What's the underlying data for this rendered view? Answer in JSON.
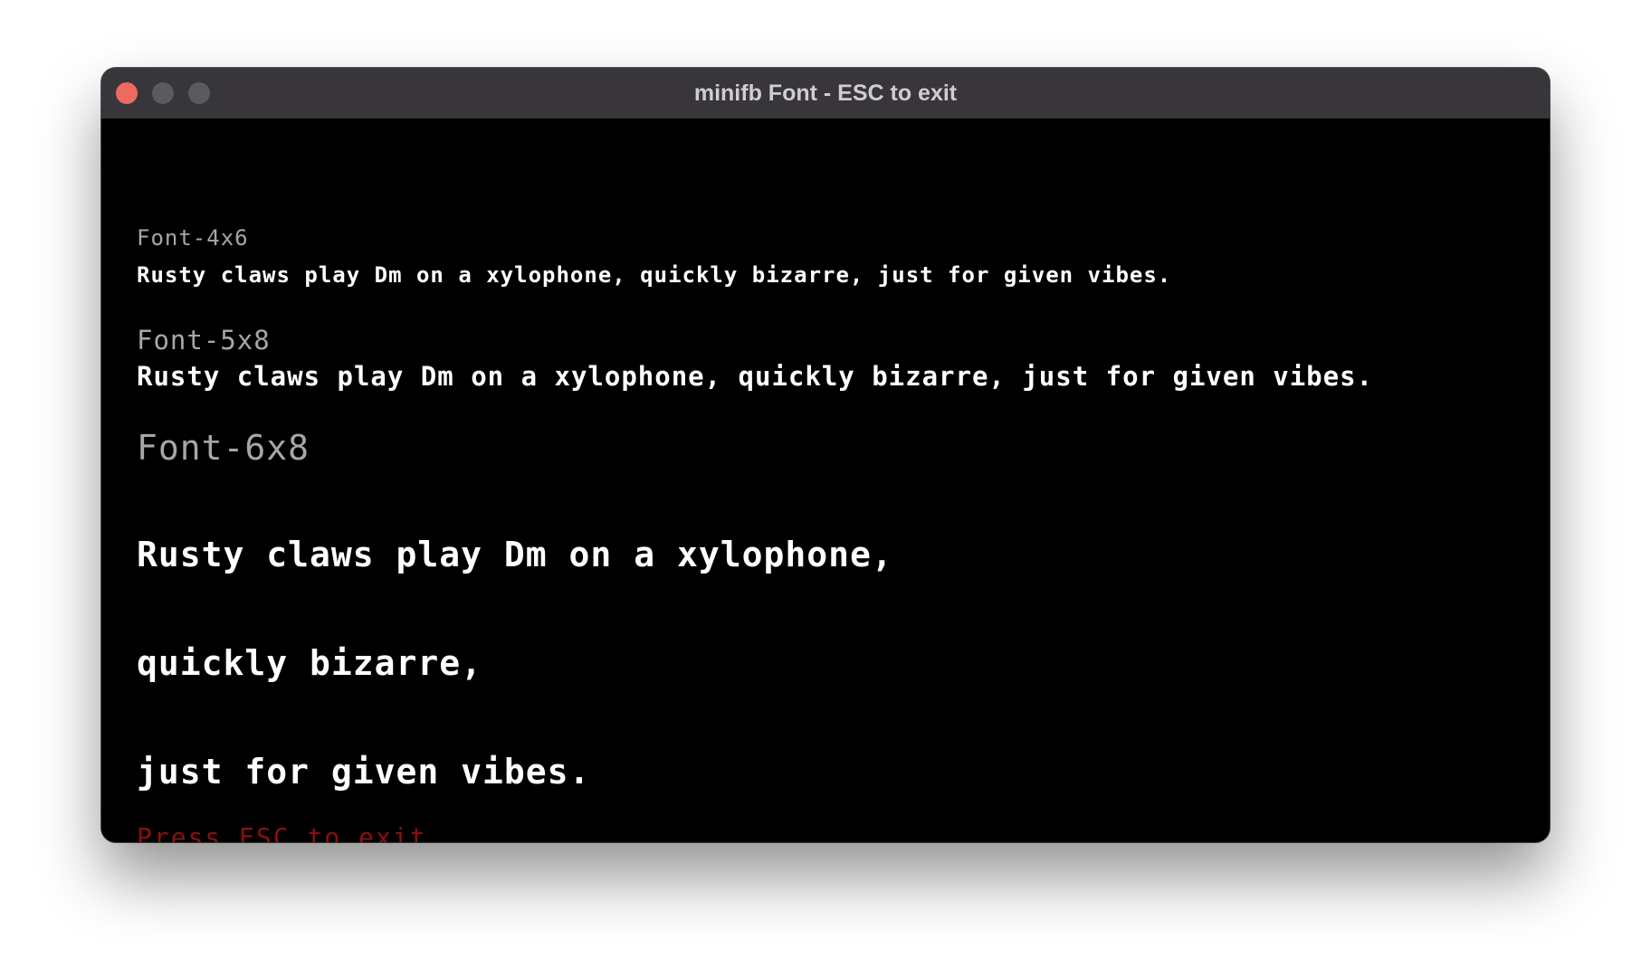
{
  "window": {
    "title": "minifb Font - ESC to exit"
  },
  "colors": {
    "titlebar": "#38363b",
    "close": "#ed6a5e",
    "inactive_button": "#5b5a5e",
    "content_bg": "#000000",
    "header_text": "#a7a7a7",
    "sample_text": "#ffffff",
    "exit_text": "#8b0f0f"
  },
  "fonts": [
    {
      "label": "Font-4x6",
      "sample": "Rusty claws play Dm on a xylophone, quickly bizarre, just for given vibes."
    },
    {
      "label": "Font-5x8",
      "sample": "Rusty claws play Dm on a xylophone, quickly bizarre, just for given vibes."
    },
    {
      "label": "Font-6x8",
      "sample_lines": [
        "Rusty claws play Dm on a xylophone,",
        "quickly bizarre,",
        "just for given vibes."
      ]
    }
  ],
  "footer": {
    "exit_hint": "Press ESC to exit"
  }
}
